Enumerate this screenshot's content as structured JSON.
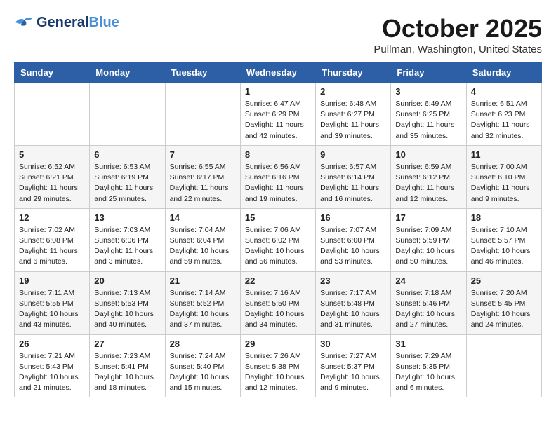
{
  "header": {
    "logo_general": "General",
    "logo_blue": "Blue",
    "month": "October 2025",
    "location": "Pullman, Washington, United States"
  },
  "days_of_week": [
    "Sunday",
    "Monday",
    "Tuesday",
    "Wednesday",
    "Thursday",
    "Friday",
    "Saturday"
  ],
  "weeks": [
    [
      {
        "day": "",
        "sunrise": "",
        "sunset": "",
        "daylight": ""
      },
      {
        "day": "",
        "sunrise": "",
        "sunset": "",
        "daylight": ""
      },
      {
        "day": "",
        "sunrise": "",
        "sunset": "",
        "daylight": ""
      },
      {
        "day": "1",
        "sunrise": "Sunrise: 6:47 AM",
        "sunset": "Sunset: 6:29 PM",
        "daylight": "Daylight: 11 hours and 42 minutes."
      },
      {
        "day": "2",
        "sunrise": "Sunrise: 6:48 AM",
        "sunset": "Sunset: 6:27 PM",
        "daylight": "Daylight: 11 hours and 39 minutes."
      },
      {
        "day": "3",
        "sunrise": "Sunrise: 6:49 AM",
        "sunset": "Sunset: 6:25 PM",
        "daylight": "Daylight: 11 hours and 35 minutes."
      },
      {
        "day": "4",
        "sunrise": "Sunrise: 6:51 AM",
        "sunset": "Sunset: 6:23 PM",
        "daylight": "Daylight: 11 hours and 32 minutes."
      }
    ],
    [
      {
        "day": "5",
        "sunrise": "Sunrise: 6:52 AM",
        "sunset": "Sunset: 6:21 PM",
        "daylight": "Daylight: 11 hours and 29 minutes."
      },
      {
        "day": "6",
        "sunrise": "Sunrise: 6:53 AM",
        "sunset": "Sunset: 6:19 PM",
        "daylight": "Daylight: 11 hours and 25 minutes."
      },
      {
        "day": "7",
        "sunrise": "Sunrise: 6:55 AM",
        "sunset": "Sunset: 6:17 PM",
        "daylight": "Daylight: 11 hours and 22 minutes."
      },
      {
        "day": "8",
        "sunrise": "Sunrise: 6:56 AM",
        "sunset": "Sunset: 6:16 PM",
        "daylight": "Daylight: 11 hours and 19 minutes."
      },
      {
        "day": "9",
        "sunrise": "Sunrise: 6:57 AM",
        "sunset": "Sunset: 6:14 PM",
        "daylight": "Daylight: 11 hours and 16 minutes."
      },
      {
        "day": "10",
        "sunrise": "Sunrise: 6:59 AM",
        "sunset": "Sunset: 6:12 PM",
        "daylight": "Daylight: 11 hours and 12 minutes."
      },
      {
        "day": "11",
        "sunrise": "Sunrise: 7:00 AM",
        "sunset": "Sunset: 6:10 PM",
        "daylight": "Daylight: 11 hours and 9 minutes."
      }
    ],
    [
      {
        "day": "12",
        "sunrise": "Sunrise: 7:02 AM",
        "sunset": "Sunset: 6:08 PM",
        "daylight": "Daylight: 11 hours and 6 minutes."
      },
      {
        "day": "13",
        "sunrise": "Sunrise: 7:03 AM",
        "sunset": "Sunset: 6:06 PM",
        "daylight": "Daylight: 11 hours and 3 minutes."
      },
      {
        "day": "14",
        "sunrise": "Sunrise: 7:04 AM",
        "sunset": "Sunset: 6:04 PM",
        "daylight": "Daylight: 10 hours and 59 minutes."
      },
      {
        "day": "15",
        "sunrise": "Sunrise: 7:06 AM",
        "sunset": "Sunset: 6:02 PM",
        "daylight": "Daylight: 10 hours and 56 minutes."
      },
      {
        "day": "16",
        "sunrise": "Sunrise: 7:07 AM",
        "sunset": "Sunset: 6:00 PM",
        "daylight": "Daylight: 10 hours and 53 minutes."
      },
      {
        "day": "17",
        "sunrise": "Sunrise: 7:09 AM",
        "sunset": "Sunset: 5:59 PM",
        "daylight": "Daylight: 10 hours and 50 minutes."
      },
      {
        "day": "18",
        "sunrise": "Sunrise: 7:10 AM",
        "sunset": "Sunset: 5:57 PM",
        "daylight": "Daylight: 10 hours and 46 minutes."
      }
    ],
    [
      {
        "day": "19",
        "sunrise": "Sunrise: 7:11 AM",
        "sunset": "Sunset: 5:55 PM",
        "daylight": "Daylight: 10 hours and 43 minutes."
      },
      {
        "day": "20",
        "sunrise": "Sunrise: 7:13 AM",
        "sunset": "Sunset: 5:53 PM",
        "daylight": "Daylight: 10 hours and 40 minutes."
      },
      {
        "day": "21",
        "sunrise": "Sunrise: 7:14 AM",
        "sunset": "Sunset: 5:52 PM",
        "daylight": "Daylight: 10 hours and 37 minutes."
      },
      {
        "day": "22",
        "sunrise": "Sunrise: 7:16 AM",
        "sunset": "Sunset: 5:50 PM",
        "daylight": "Daylight: 10 hours and 34 minutes."
      },
      {
        "day": "23",
        "sunrise": "Sunrise: 7:17 AM",
        "sunset": "Sunset: 5:48 PM",
        "daylight": "Daylight: 10 hours and 31 minutes."
      },
      {
        "day": "24",
        "sunrise": "Sunrise: 7:18 AM",
        "sunset": "Sunset: 5:46 PM",
        "daylight": "Daylight: 10 hours and 27 minutes."
      },
      {
        "day": "25",
        "sunrise": "Sunrise: 7:20 AM",
        "sunset": "Sunset: 5:45 PM",
        "daylight": "Daylight: 10 hours and 24 minutes."
      }
    ],
    [
      {
        "day": "26",
        "sunrise": "Sunrise: 7:21 AM",
        "sunset": "Sunset: 5:43 PM",
        "daylight": "Daylight: 10 hours and 21 minutes."
      },
      {
        "day": "27",
        "sunrise": "Sunrise: 7:23 AM",
        "sunset": "Sunset: 5:41 PM",
        "daylight": "Daylight: 10 hours and 18 minutes."
      },
      {
        "day": "28",
        "sunrise": "Sunrise: 7:24 AM",
        "sunset": "Sunset: 5:40 PM",
        "daylight": "Daylight: 10 hours and 15 minutes."
      },
      {
        "day": "29",
        "sunrise": "Sunrise: 7:26 AM",
        "sunset": "Sunset: 5:38 PM",
        "daylight": "Daylight: 10 hours and 12 minutes."
      },
      {
        "day": "30",
        "sunrise": "Sunrise: 7:27 AM",
        "sunset": "Sunset: 5:37 PM",
        "daylight": "Daylight: 10 hours and 9 minutes."
      },
      {
        "day": "31",
        "sunrise": "Sunrise: 7:29 AM",
        "sunset": "Sunset: 5:35 PM",
        "daylight": "Daylight: 10 hours and 6 minutes."
      },
      {
        "day": "",
        "sunrise": "",
        "sunset": "",
        "daylight": ""
      }
    ]
  ]
}
